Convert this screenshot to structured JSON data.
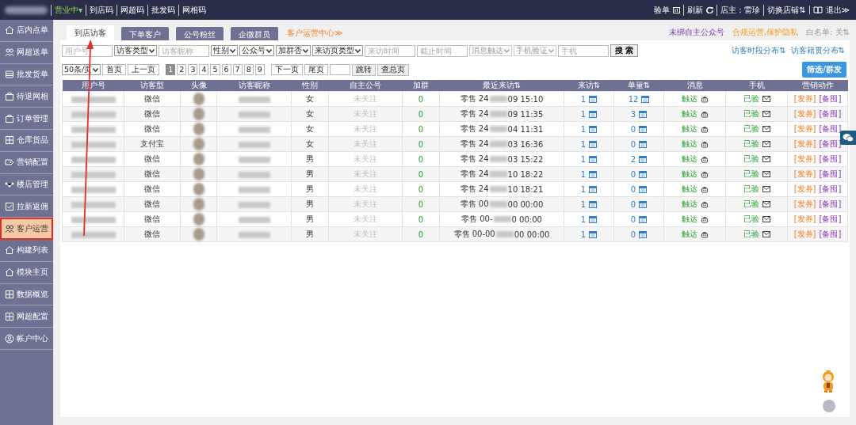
{
  "top_bar": {
    "status": "营业中▾",
    "links": [
      "到店码",
      "网超码",
      "批发码",
      "网相码"
    ],
    "right": {
      "check": "验单",
      "refresh": "刷新",
      "owner": "店主：雷珍",
      "switch": "切换店铺⇅",
      "logout": "退出≫"
    }
  },
  "sidebar": {
    "items": [
      {
        "label": "店内点单",
        "selected": false
      },
      {
        "label": "网超送单",
        "selected": false
      },
      {
        "label": "批发货单",
        "selected": false
      },
      {
        "label": "待退网相",
        "selected": false
      },
      {
        "label": "订单管理",
        "selected": false
      },
      {
        "label": "仓库货品",
        "selected": false
      },
      {
        "label": "营销配置",
        "selected": false
      },
      {
        "label": "楼店管理",
        "selected": false
      },
      {
        "label": "拉新返佣",
        "selected": false
      },
      {
        "label": "客户运营",
        "selected": true
      },
      {
        "label": "构建列表",
        "selected": false
      },
      {
        "label": "模块主页",
        "selected": false
      },
      {
        "label": "数据概览",
        "selected": false
      },
      {
        "label": "网超配置",
        "selected": false
      },
      {
        "label": "帐户中心",
        "selected": false
      }
    ]
  },
  "tabs": [
    {
      "label": "到店访客",
      "selected": true
    },
    {
      "label": "下单客户",
      "selected": false
    },
    {
      "label": "公号粉丝",
      "selected": false
    },
    {
      "label": "企微群员",
      "selected": false
    }
  ],
  "center_link": "客户运营中心≫",
  "notices": [
    "未绑自主公众号",
    "合规运营,保护隐私",
    "白名单: 关⇅"
  ],
  "filters": [
    {
      "kind": "input",
      "placeholder": "用户号",
      "disabled": false
    },
    {
      "kind": "select",
      "label": "访客类型",
      "disabled": false
    },
    {
      "kind": "input",
      "placeholder": "访客昵称",
      "disabled": false
    },
    {
      "kind": "select",
      "label": "性别",
      "disabled": false
    },
    {
      "kind": "select",
      "label": "公众号",
      "disabled": false
    },
    {
      "kind": "select",
      "label": "加群否",
      "disabled": false
    },
    {
      "kind": "select",
      "label": "来访页类型",
      "disabled": false
    },
    {
      "kind": "input",
      "placeholder": "来访时间",
      "disabled": false
    },
    {
      "kind": "input",
      "placeholder": "截止时间",
      "disabled": false
    },
    {
      "kind": "select",
      "label": "消息触达",
      "disabled": true
    },
    {
      "kind": "select",
      "label": "手机验证",
      "disabled": true
    },
    {
      "kind": "input",
      "placeholder": "手机",
      "disabled": false
    },
    {
      "kind": "button",
      "label": "搜 索",
      "disabled": false
    }
  ],
  "distribution_links": [
    "访客时段分布⇅",
    "访客籍贯分布⇅"
  ],
  "pagination": {
    "page_size": "50条/页",
    "first": "首页",
    "prev": "上一页",
    "pages": [
      {
        "label": "1",
        "selected": true
      },
      {
        "label": "2",
        "selected": false
      },
      {
        "label": "3",
        "selected": false
      },
      {
        "label": "4",
        "selected": false
      },
      {
        "label": "5",
        "selected": false
      },
      {
        "label": "6",
        "selected": false
      },
      {
        "label": "7",
        "selected": false
      },
      {
        "label": "8",
        "selected": false
      },
      {
        "label": "9",
        "selected": false
      }
    ],
    "next": "下一页",
    "last": "尾页",
    "jump": "跳转",
    "total": "查总页"
  },
  "bulk_button": "筛选/群发",
  "table": {
    "columns": [
      "用户号",
      "访客型",
      "头像",
      "访客昵称",
      "性别",
      "自主公号",
      "加群",
      "最近来访⇅",
      "来访⇅",
      "单量⇅",
      "消息",
      "手机",
      "营销动作"
    ],
    "rows": [
      {
        "type": "微信",
        "gender": "女",
        "account": "未关注",
        "group": "0",
        "visit_prefix": "零售 24",
        "visit_suffix": "09 15:10",
        "visits": "1",
        "orders": "12",
        "message": "触达",
        "phone": "已验",
        "actions": [
          "[发券]",
          "[备囤]"
        ]
      },
      {
        "type": "微信",
        "gender": "女",
        "account": "未关注",
        "group": "0",
        "visit_prefix": "零售 24",
        "visit_suffix": "09 11:35",
        "visits": "1",
        "orders": "3",
        "message": "触达",
        "phone": "已验",
        "actions": [
          "[发券]",
          "[备囤]"
        ]
      },
      {
        "type": "微信",
        "gender": "女",
        "account": "未关注",
        "group": "0",
        "visit_prefix": "零售 24",
        "visit_suffix": "04 11:31",
        "visits": "1",
        "orders": "0",
        "message": "触达",
        "phone": "已验",
        "actions": [
          "[发券]",
          "[备囤]"
        ]
      },
      {
        "type": "支付宝",
        "gender": "女",
        "account": "未关注",
        "group": "0",
        "visit_prefix": "零售 24",
        "visit_suffix": "03 16:36",
        "visits": "1",
        "orders": "0",
        "message": "触达",
        "phone": "已验",
        "actions": [
          "[发券]",
          "[备囤]"
        ]
      },
      {
        "type": "微信",
        "gender": "男",
        "account": "未关注",
        "group": "0",
        "visit_prefix": "零售 24",
        "visit_suffix": "03 15:22",
        "visits": "1",
        "orders": "2",
        "message": "触达",
        "phone": "已验",
        "actions": [
          "[发券]",
          "[备囤]"
        ]
      },
      {
        "type": "微信",
        "gender": "男",
        "account": "未关注",
        "group": "0",
        "visit_prefix": "零售 24",
        "visit_suffix": "10 18:22",
        "visits": "1",
        "orders": "0",
        "message": "触达",
        "phone": "已验",
        "actions": [
          "[发券]",
          "[备囤]"
        ]
      },
      {
        "type": "微信",
        "gender": "男",
        "account": "未关注",
        "group": "0",
        "visit_prefix": "零售 24",
        "visit_suffix": "10 18:21",
        "visits": "1",
        "orders": "0",
        "message": "触达",
        "phone": "已验",
        "actions": [
          "[发券]",
          "[备囤]"
        ]
      },
      {
        "type": "微信",
        "gender": "男",
        "account": "未关注",
        "group": "0",
        "visit_prefix": "零售 00",
        "visit_suffix": "00 00:00",
        "visits": "1",
        "orders": "0",
        "message": "触达",
        "phone": "已验",
        "actions": [
          "[发券]",
          "[备囤]"
        ]
      },
      {
        "type": "微信",
        "gender": "男",
        "account": "未关注",
        "group": "0",
        "visit_prefix": "零售 00-",
        "visit_suffix": "0 00:00",
        "visits": "1",
        "orders": "0",
        "message": "触达",
        "phone": "已验",
        "actions": [
          "[发券]",
          "[备囤]"
        ]
      },
      {
        "type": "微信",
        "gender": "男",
        "account": "未关注",
        "group": "0",
        "visit_prefix": "零售 00-00",
        "visit_suffix": "00 00:00",
        "visits": "1",
        "orders": "0",
        "message": "触达",
        "phone": "已验",
        "actions": [
          "[发券]",
          "[备囤]"
        ]
      }
    ]
  }
}
